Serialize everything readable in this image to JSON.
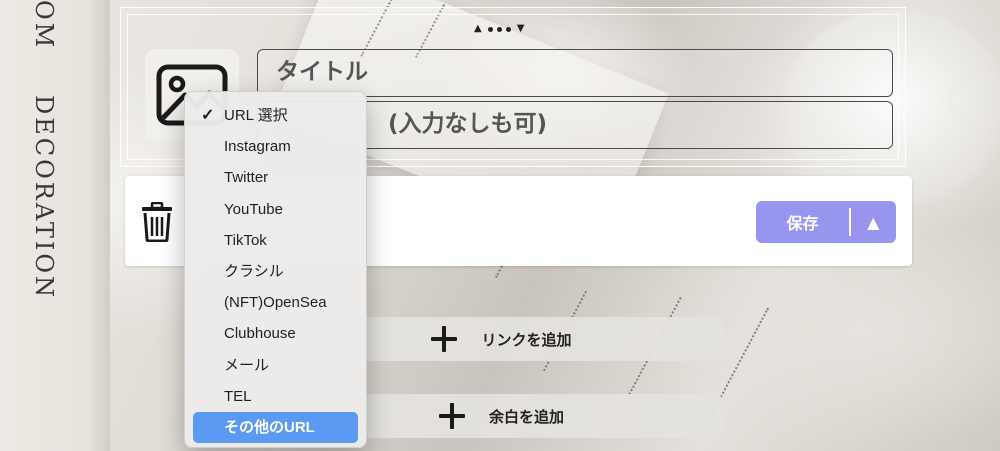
{
  "background": {
    "spine_word_1": "OM",
    "spine_word_2": "DECORATION"
  },
  "header": {
    "title_placeholder": "タイトル",
    "subtitle_placeholder": "(入力なしも可)",
    "image_icon": "image-icon",
    "drag_handle_icon": "drag-handle-icon"
  },
  "link_card": {
    "delete_icon": "trash-icon",
    "save_label": "保存",
    "expand_icon": "triangle-up-icon",
    "save_color": "#9895ef"
  },
  "url_menu": {
    "items": [
      {
        "label": "URL 選択",
        "checked": true
      },
      {
        "label": "Instagram"
      },
      {
        "label": "Twitter"
      },
      {
        "label": "YouTube"
      },
      {
        "label": "TikTok"
      },
      {
        "label": "クラシル"
      },
      {
        "label": "(NFT)OpenSea"
      },
      {
        "label": "Clubhouse"
      },
      {
        "label": "メール"
      },
      {
        "label": "TEL"
      },
      {
        "label": "その他のURL",
        "highlighted": true
      }
    ],
    "highlight_color": "#5b9af2"
  },
  "actions": {
    "add_link_label": "リンクを追加",
    "add_space_label": "余白を追加"
  }
}
